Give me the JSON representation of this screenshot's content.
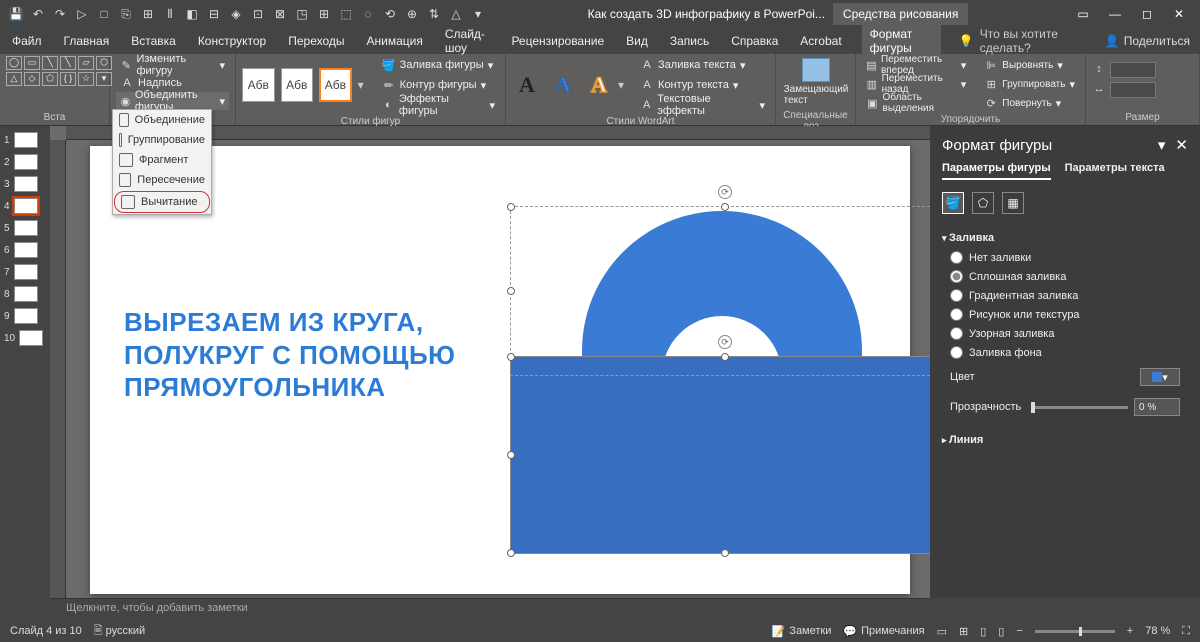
{
  "titlebar": {
    "doc_title": "Как создать 3D инфографику в PowerPoi...",
    "context_tab": "Средства рисования"
  },
  "menus": {
    "items": [
      "Файл",
      "Главная",
      "Вставка",
      "Конструктор",
      "Переходы",
      "Анимация",
      "Слайд-шоу",
      "Рецензирование",
      "Вид",
      "Запись",
      "Справка",
      "Acrobat",
      "Формат фигуры"
    ],
    "active_idx": 12,
    "tell_me": "Что вы хотите сделать?",
    "share": "Поделиться"
  },
  "ribbon": {
    "group_insert": "Вста",
    "edit_shape": "Изменить фигуру",
    "text_box": "Надпись",
    "merge_shapes": "Объединить фигуры",
    "group_styles": "Стили фигур",
    "fill": "Заливка фигуры",
    "outline": "Контур фигуры",
    "effects": "Эффекты фигуры",
    "abv": "Абв",
    "group_wordart": "Стили WordArt",
    "text_fill": "Заливка текста",
    "text_outline": "Контур текста",
    "text_effects": "Текстовые эффекты",
    "group_alt": "Специальные воз...",
    "alt_text": "Замещающий текст",
    "group_arrange": "Упорядочить",
    "bring_forward": "Переместить вперед",
    "send_backward": "Переместить назад",
    "selection_pane": "Область выделения",
    "align": "Выровнять",
    "group": "Группировать",
    "rotate": "Повернуть",
    "group_size": "Размер"
  },
  "dropmenu": {
    "items": [
      "Объединение",
      "Группирование",
      "Фрагмент",
      "Пересечение",
      "Вычитание"
    ],
    "hl_idx": 4
  },
  "thumbs": {
    "count": 10,
    "selected": 4
  },
  "slide": {
    "text": "ВЫРЕЗАЕМ ИЗ КРУГА, ПОЛУКРУГ С ПОМОЩЬЮ ПРЯМОУГОЛЬНИКА"
  },
  "rpanel": {
    "title": "Формат фигуры",
    "tabs": [
      "Параметры фигуры",
      "Параметры текста"
    ],
    "active_tab": 0,
    "section_fill": "Заливка",
    "fill_options": [
      "Нет заливки",
      "Сплошная заливка",
      "Градиентная заливка",
      "Рисунок или текстура",
      "Узорная заливка",
      "Заливка фона"
    ],
    "fill_selected": 1,
    "color_label": "Цвет",
    "opacity_label": "Прозрачность",
    "opacity_value": "0 %",
    "section_line": "Линия"
  },
  "notes": {
    "placeholder": "Щелкните, чтобы добавить заметки"
  },
  "status": {
    "slide": "Слайд 4 из 10",
    "lang": "русский",
    "notes_btn": "Заметки",
    "comments_btn": "Примечания",
    "zoom": "78 %"
  }
}
